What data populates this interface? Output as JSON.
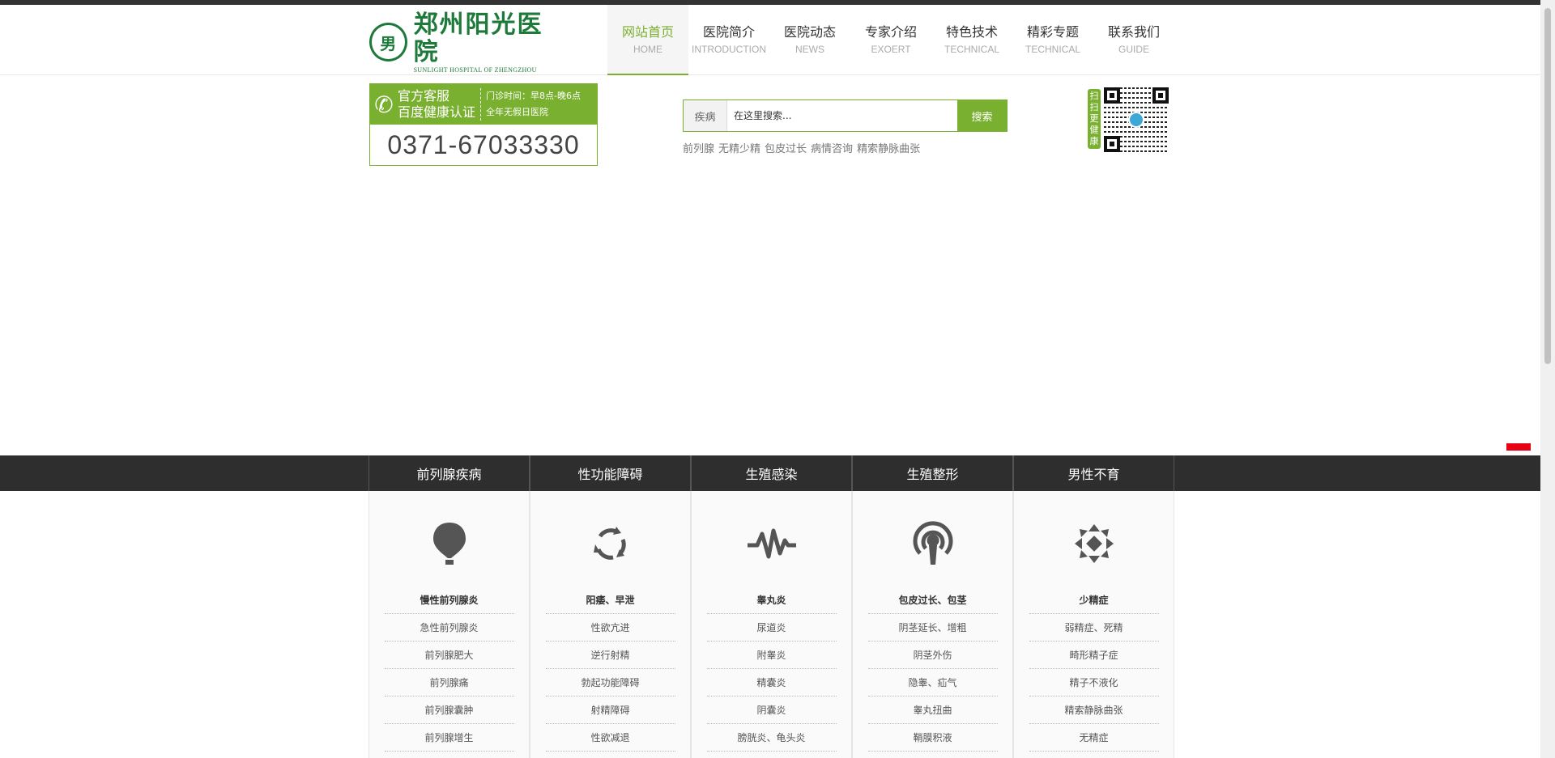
{
  "header": {
    "logo": {
      "badge_char": "男",
      "name_cn": "郑州阳光医院",
      "name_en": "SUNLIGHT HOSPITAL OF ZHENGZHOU"
    },
    "nav": [
      {
        "cn": "网站首页",
        "en": "HOME",
        "active": true
      },
      {
        "cn": "医院简介",
        "en": "INTRODUCTION"
      },
      {
        "cn": "医院动态",
        "en": "NEWS"
      },
      {
        "cn": "专家介绍",
        "en": "EXOERT"
      },
      {
        "cn": "特色技术",
        "en": "TECHNICAL"
      },
      {
        "cn": "精彩专题",
        "en": "TECHNICAL"
      },
      {
        "cn": "联系我们",
        "en": "GUIDE"
      }
    ]
  },
  "hotline": {
    "line1": "官方客服",
    "line2": "百度健康认证",
    "hours": "门诊时间：早8点-晚6点",
    "holiday": "全年无假日医院",
    "number": "0371-67033330"
  },
  "search": {
    "category": "疾病",
    "placeholder": "在这里搜索...",
    "button": "搜索",
    "hotwords": [
      "前列腺",
      "无精少精",
      "包皮过长",
      "病情咨询",
      "精索静脉曲张"
    ]
  },
  "qr": {
    "side_text": "扫扫更健康"
  },
  "categories": [
    {
      "title": "前列腺疾病",
      "icon": "balloon-icon",
      "items": [
        "慢性前列腺炎",
        "急性前列腺炎",
        "前列腺肥大",
        "前列腺痛",
        "前列腺囊肿",
        "前列腺增生"
      ]
    },
    {
      "title": "性功能障碍",
      "icon": "cycle-icon",
      "items": [
        "阳痿、早泄",
        "性欲亢进",
        "逆行射精",
        "勃起功能障碍",
        "射精障碍",
        "性欲减退"
      ]
    },
    {
      "title": "生殖感染",
      "icon": "pulse-icon",
      "items": [
        "睾丸炎",
        "尿道炎",
        "附睾炎",
        "精囊炎",
        "阴囊炎",
        "膀胱炎、龟头炎"
      ]
    },
    {
      "title": "生殖整形",
      "icon": "broadcast-icon",
      "items": [
        "包皮过长、包茎",
        "阴茎延长、增粗",
        "阴茎外伤",
        "隐睾、疝气",
        "睾丸扭曲",
        "鞘膜积液"
      ]
    },
    {
      "title": "男性不育",
      "icon": "arrows-icon",
      "items": [
        "少精症",
        "弱精症、死精",
        "畸形精子症",
        "精子不液化",
        "精索静脉曲张",
        "无精症"
      ]
    }
  ],
  "colors": {
    "brand_green": "#7ab030",
    "logo_green": "#1e7a3a",
    "dark_bar": "#2e2e2e",
    "red_tag": "#e60012"
  }
}
